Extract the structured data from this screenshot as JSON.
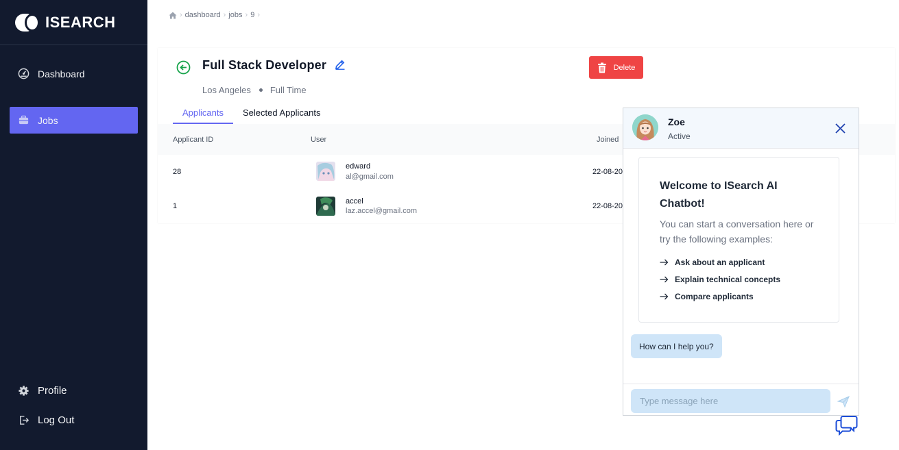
{
  "app": {
    "brand": "ISEARCH"
  },
  "sidebar": {
    "items": [
      {
        "label": "Dashboard",
        "icon": "dashboard-gauge-icon"
      },
      {
        "label": "Jobs",
        "icon": "briefcase-icon",
        "active": true
      }
    ],
    "bottom": [
      {
        "label": "Profile",
        "icon": "gear-icon"
      },
      {
        "label": "Log Out",
        "icon": "logout-icon"
      }
    ]
  },
  "breadcrumb": [
    "dashboard",
    "jobs",
    "9"
  ],
  "job": {
    "title": "Full Stack Developer",
    "location": "Los Angeles",
    "type": "Full Time",
    "delete_label": "Delete"
  },
  "tabs": [
    {
      "label": "Applicants",
      "active": true
    },
    {
      "label": "Selected Applicants",
      "active": false
    }
  ],
  "table": {
    "columns": [
      "Applicant ID",
      "User",
      "Joined"
    ],
    "rows": [
      {
        "id": "28",
        "name": "edward",
        "email": "al@gmail.com",
        "joined": "22-08-20"
      },
      {
        "id": "1",
        "name": "accel",
        "email": "laz.accel@gmail.com",
        "joined": "22-08-20"
      }
    ]
  },
  "chat": {
    "name": "Zoe",
    "status": "Active",
    "welcome_title": "Welcome to ISearch AI Chatbot!",
    "welcome_text": "You can start a conversation here or try the following examples:",
    "examples": [
      "Ask about an applicant",
      "Explain technical concepts",
      "Compare applicants"
    ],
    "bot_message": "How can I help you?",
    "input_placeholder": "Type message here"
  },
  "colors": {
    "sidebar_bg": "#121a2e",
    "accent": "#6366f1",
    "danger": "#ef4444",
    "chat_bubble": "#cfe5f8",
    "back_green": "#16a34a"
  }
}
